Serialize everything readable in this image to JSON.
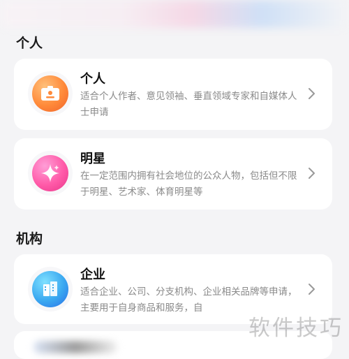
{
  "sections": {
    "personal": {
      "title": "个人"
    },
    "organization": {
      "title": "机构"
    }
  },
  "cards": [
    {
      "title": "个人",
      "desc": "适合个人作者、意见领袖、垂直领域专家和自媒体人士申请",
      "icon": "id-card-icon",
      "color": "#ff8a3a"
    },
    {
      "title": "明星",
      "desc": "在一定范围内拥有社会地位的公众人物，包括但不限于明星、艺术家、体育明星等",
      "icon": "sparkle-star-icon",
      "color": "#ff5aa8"
    },
    {
      "title": "企业",
      "desc": "适合企业、公司、分支机构、企业相关品牌等申请，主要用于自身商品和服务，自",
      "icon": "building-icon",
      "color": "#3aa8f0"
    }
  ],
  "watermark": "软件技巧"
}
